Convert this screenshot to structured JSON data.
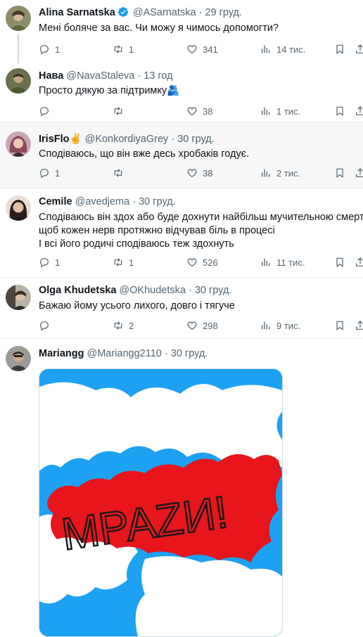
{
  "tweets": [
    {
      "name": "Alina Sarnatska",
      "verified": true,
      "handle": "@ASarnatska",
      "date": "29 груд.",
      "lines": [
        "Мені боляче за вас. Чи можу я чимось допомогти?"
      ],
      "replies": "1",
      "retweets": "1",
      "likes": "341",
      "views": "14 тис."
    },
    {
      "name": "Нава",
      "handle": "@NavaStaleva",
      "date": "13 год",
      "lines": [
        "Просто дякую за підтримку🫂"
      ],
      "replies": "",
      "retweets": "",
      "likes": "38",
      "views": "1 тис."
    },
    {
      "name": "IrisFlo✌️",
      "handle": "@KonkordiyaGrey",
      "date": "30 груд.",
      "lines": [
        "Сподіваюсь, що він вже десь хробаків годує."
      ],
      "replies": "1",
      "retweets": "",
      "likes": "38",
      "views": "2 тис."
    },
    {
      "name": "Cemile",
      "handle": "@avedjema",
      "date": "30 груд.",
      "lines": [
        "Сподіваюсь він здох або буде дохнути найбільш мучительною смертю,",
        "щоб кожен нерв протяжно відчував біль в процесі",
        "І всі його родичі сподіваюсь теж здохнуть"
      ],
      "replies": "1",
      "retweets": "1",
      "likes": "526",
      "views": "11 тис."
    },
    {
      "name": "Olga Khudetska",
      "handle": "@OKhudetska",
      "date": "30 груд.",
      "lines": [
        "Бажаю йому усього лихого, довго і тягуче"
      ],
      "replies": "",
      "retweets": "2",
      "likes": "298",
      "views": "9 тис."
    },
    {
      "name": "Mariangg",
      "handle": "@Mariangg2110",
      "date": "30 груд.",
      "image_text": "МРАZИ!"
    }
  ],
  "separator": "·",
  "colors": {
    "text": "#0f1419",
    "secondary": "#536471",
    "verified": "#1d9bf0",
    "shaded_row": "#f7f7f7",
    "map_sea": "#1da1f2",
    "map_russia": "#e8151c"
  }
}
